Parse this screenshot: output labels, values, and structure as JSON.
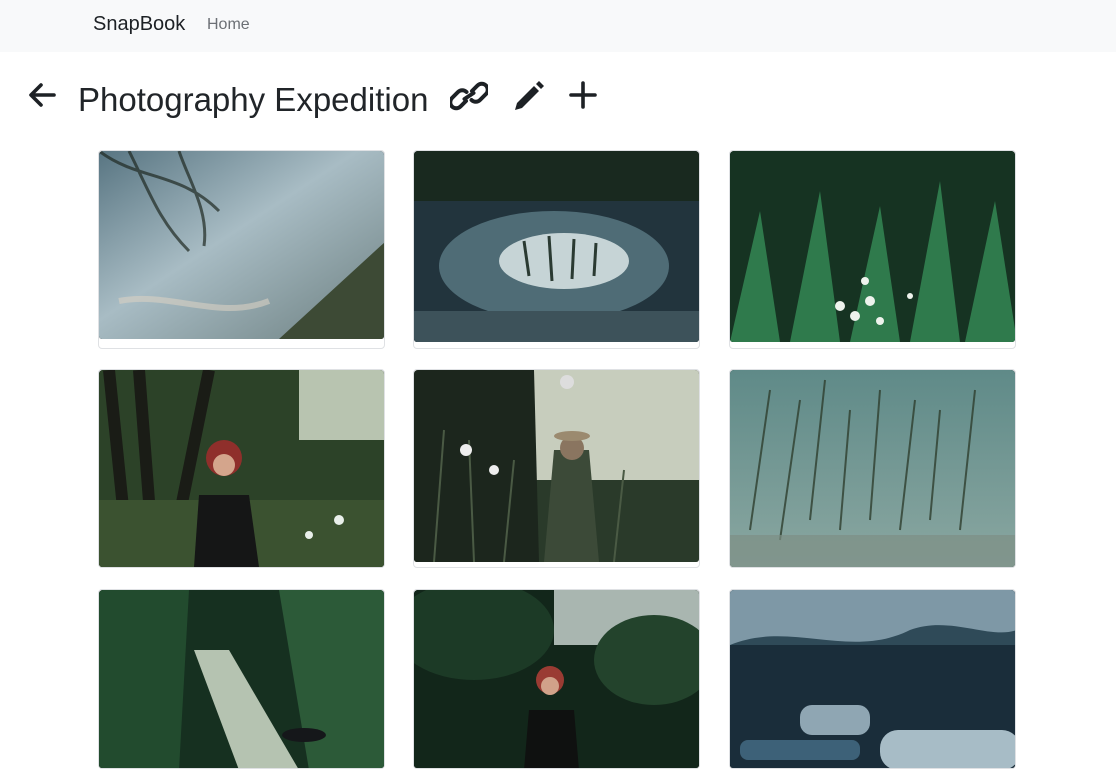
{
  "navbar": {
    "brand": "SnapBook",
    "home_label": "Home"
  },
  "album": {
    "title": "Photography Expedition",
    "actions": {
      "back_icon": "arrow-left-icon",
      "share_icon": "link-icon",
      "edit_icon": "pencil-icon",
      "add_icon": "plus-icon"
    }
  },
  "photos": [
    {
      "subject": "river-water-reflection",
      "palette": [
        "#6f8a97",
        "#a7b8bf",
        "#3a4a3a"
      ]
    },
    {
      "subject": "forest-puddle-reflection",
      "palette": [
        "#22343d",
        "#5f7d86",
        "#c6d4d6"
      ]
    },
    {
      "subject": "wildflowers-green-plants",
      "palette": [
        "#12301f",
        "#2f7a4c",
        "#e7efe6"
      ]
    },
    {
      "subject": "woman-red-hair-forest",
      "palette": [
        "#1f2c1f",
        "#3c5a34",
        "#8f2f2b"
      ]
    },
    {
      "subject": "man-in-hat-wildflowers",
      "palette": [
        "#1c261d",
        "#5a6f55",
        "#c7cdbd"
      ]
    },
    {
      "subject": "reeds-underwater-river",
      "palette": [
        "#3f6a66",
        "#6f9390",
        "#2b3f33"
      ]
    },
    {
      "subject": "boardwalk-forest-path",
      "palette": [
        "#163020",
        "#3b6a45",
        "#b5c3b1"
      ]
    },
    {
      "subject": "woman-red-hair-woods",
      "palette": [
        "#12261a",
        "#2d5236",
        "#9a3b33"
      ]
    },
    {
      "subject": "fallen-logs-forest",
      "palette": [
        "#1a2d3a",
        "#3d6178",
        "#8fa6b3"
      ]
    }
  ]
}
